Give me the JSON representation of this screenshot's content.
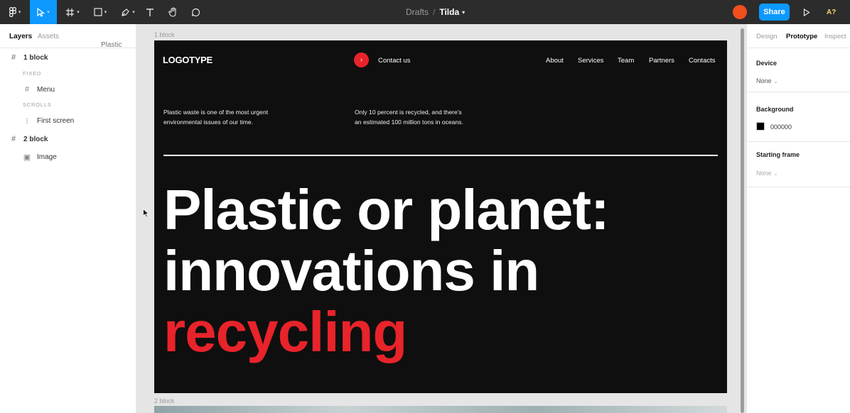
{
  "toolbar": {
    "breadcrumb_parent": "Drafts",
    "breadcrumb_sep": "/",
    "file_name": "Tilda",
    "share_label": "Share",
    "zoom_label": "A?",
    "caret": "▾"
  },
  "left_panel": {
    "tab_layers": "Layers",
    "tab_assets": "Assets",
    "page_name": "Plastic",
    "caret": "▾",
    "layers": [
      {
        "label": "1 block",
        "glyph": "#"
      },
      {
        "label": "FIXED"
      },
      {
        "label": "Menu",
        "glyph": "#"
      },
      {
        "label": "SCROLLS"
      },
      {
        "label": "First screen",
        "glyph": "⁝"
      },
      {
        "label": "2 block",
        "glyph": "#"
      },
      {
        "label": "Image",
        "glyph": "▣"
      }
    ]
  },
  "canvas": {
    "frame1_label": "1 block",
    "frame2_label": "2 block",
    "site": {
      "logo": "LOGOTYPE",
      "contact_arrow": "›",
      "contact": "Contact us",
      "nav": [
        "About",
        "Services",
        "Team",
        "Partners",
        "Contacts"
      ],
      "para1_line1": "Plastic waste is one of the most urgent",
      "para1_line2": "environmental issues of our time.",
      "para2_line1": "Only 10 percent is recycled, and there's",
      "para2_line2": "an estimated 100 million tons in oceans.",
      "headline_line1": "Plastic or planet:",
      "headline_line2": "innovations in",
      "headline_line3": "recycling"
    }
  },
  "right_panel": {
    "tabs": [
      "Design",
      "Prototype",
      "Inspect"
    ],
    "device_label": "Device",
    "device_value": "None",
    "background_label": "Background",
    "background_value": "000000",
    "starting_frame_label": "Starting frame",
    "starting_frame_value": "None",
    "caret": "⌄"
  },
  "colors": {
    "accent": "#0d99ff",
    "brand_red": "#e8232a",
    "toolbar_bg": "#2c2c2c",
    "frame_bg": "#0f0f0f"
  }
}
